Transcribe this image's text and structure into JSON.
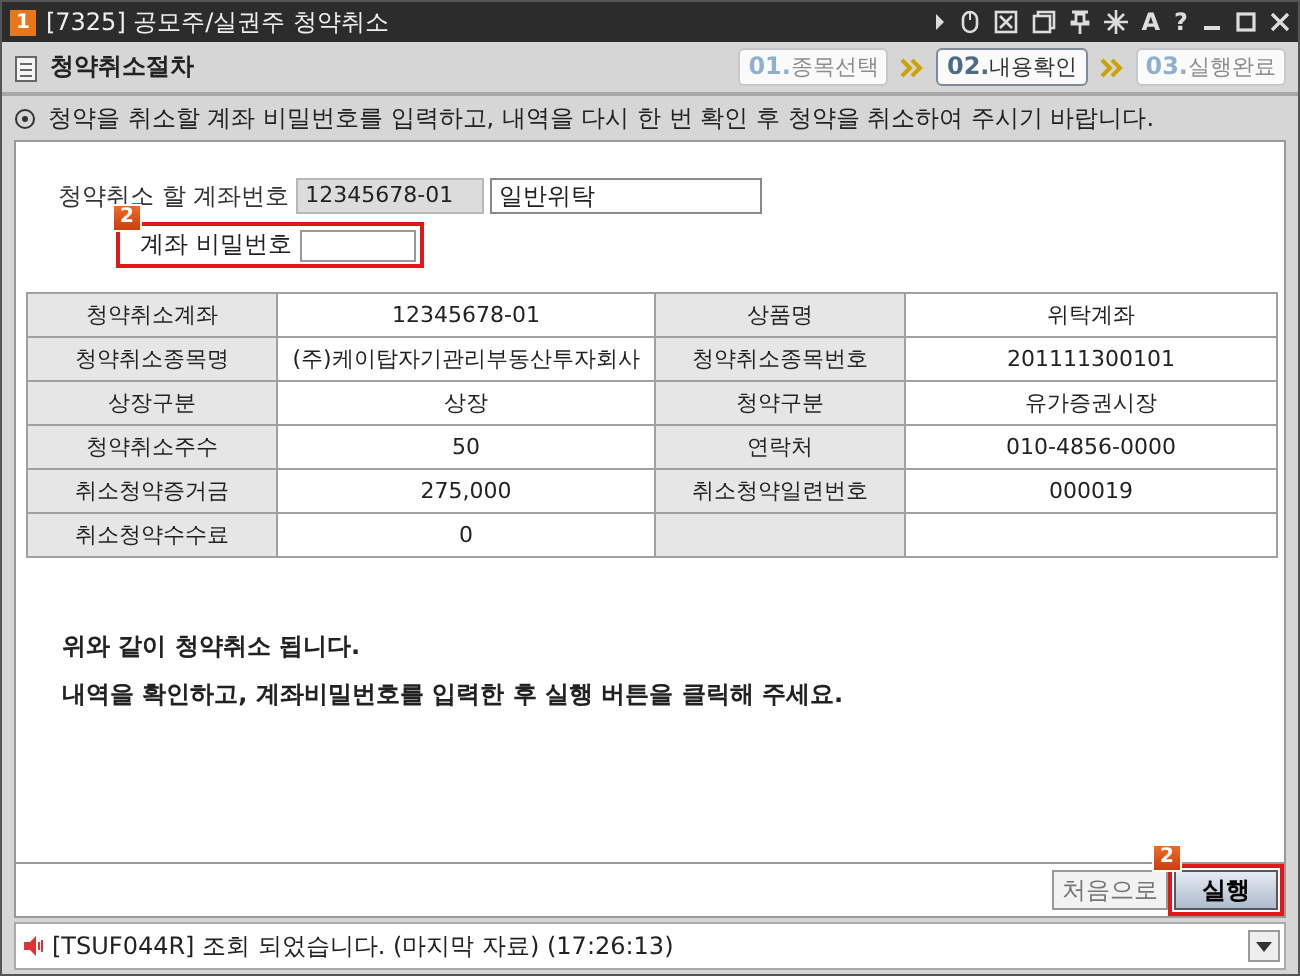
{
  "window": {
    "number": "1",
    "title": "[7325] 공모주/실권주 청약취소",
    "font_button": "A",
    "help_button": "?"
  },
  "header": {
    "title": "청약취소절차",
    "steps": [
      {
        "number": "01.",
        "label": "종목선택",
        "selected": false
      },
      {
        "number": "02.",
        "label": "내용확인",
        "selected": true
      },
      {
        "number": "03.",
        "label": "실행완료",
        "selected": false
      }
    ]
  },
  "notice": "청약을 취소할 계좌 비밀번호를 입력하고, 내역을 다시 한 번 확인 후 청약을 취소하여 주시기 바랍니다.",
  "form": {
    "account_label": "청약취소 할 계좌번호",
    "account_number": "12345678-01",
    "account_type": "일반위탁",
    "password_label": "계좌 비밀번호",
    "password_badge": "2"
  },
  "table": {
    "rows": [
      [
        "청약취소계좌",
        "12345678-01",
        "상품명",
        "위탁계좌"
      ],
      [
        "청약취소종목명",
        "(주)케이탑자기관리부동산투자회사",
        "청약취소종목번호",
        "201111300101"
      ],
      [
        "상장구분",
        "상장",
        "청약구분",
        "유가증권시장"
      ],
      [
        "청약취소주수",
        "50",
        "연락처",
        "010-4856-0000"
      ],
      [
        "취소청약증거금",
        "275,000",
        "취소청약일련번호",
        "000019"
      ],
      [
        "취소청약수수료",
        "0",
        "",
        ""
      ]
    ]
  },
  "messages": [
    "위와 같이 청약취소 됩니다.",
    "내역을 확인하고, 계좌비밀번호를 입력한 후 실행 버튼을 클릭해 주세요."
  ],
  "buttons": {
    "reset": "처음으로",
    "execute": "실행",
    "execute_badge": "2"
  },
  "status_bar": "[TSUF044R] 조회 되었습니다. (마지막 자료) (17:26:13)"
}
